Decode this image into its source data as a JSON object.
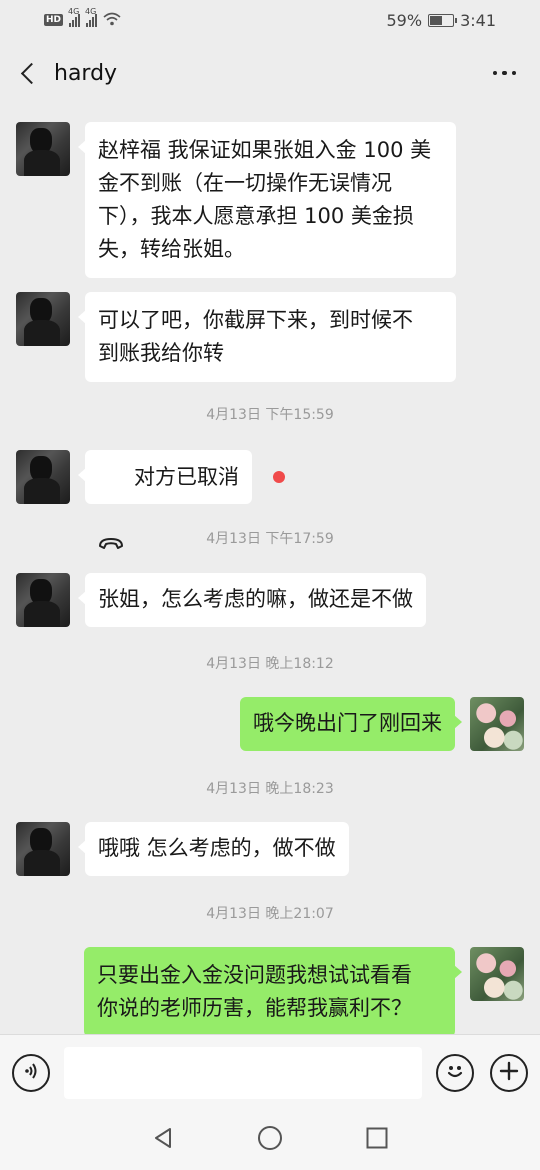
{
  "status_bar": {
    "hd_label": "HD",
    "network_1": "4G",
    "network_2": "4G",
    "battery_percent": "59%",
    "battery_level": 0.59,
    "time": "3:41"
  },
  "header": {
    "title": "hardy"
  },
  "messages": [
    {
      "side": "left",
      "text": "赵梓福 我保证如果张姐入金 100 美\n金不到账（在一切操作无误情况\n下），我本人愿意承担 100 美金损\n失，转给张姐。"
    },
    {
      "side": "left",
      "text": "可以了吧，你截屏下来，到时候不\n到账我给你转"
    },
    {
      "timestamp": "4月13日 下午15:59"
    },
    {
      "side": "left",
      "call": true,
      "text": "对方已取消"
    },
    {
      "timestamp": "4月13日 下午17:59"
    },
    {
      "side": "left",
      "text": "张姐，怎么考虑的嘛，做还是不做"
    },
    {
      "timestamp": "4月13日 晚上18:12"
    },
    {
      "side": "right",
      "text": "哦今晚出门了刚回来"
    },
    {
      "timestamp": "4月13日 晚上18:23"
    },
    {
      "side": "left",
      "text": "哦哦 怎么考虑的，做不做"
    },
    {
      "timestamp": "4月13日 晚上21:07"
    },
    {
      "side": "right",
      "text": "只要出金入金没问题我想试试看看\n你说的老师历害，能帮我赢利不？"
    }
  ],
  "input_bar": {
    "placeholder": ""
  },
  "icons": {
    "voice": "voice-icon",
    "emoji": "emoji-icon",
    "add": "add-icon",
    "back": "back-icon",
    "more": "more-icon",
    "call": "phone-icon"
  },
  "colors": {
    "background": "#ededed",
    "outgoing_bubble": "#95ec69",
    "incoming_bubble": "#ffffff",
    "unread_dot": "#f04a4a"
  }
}
